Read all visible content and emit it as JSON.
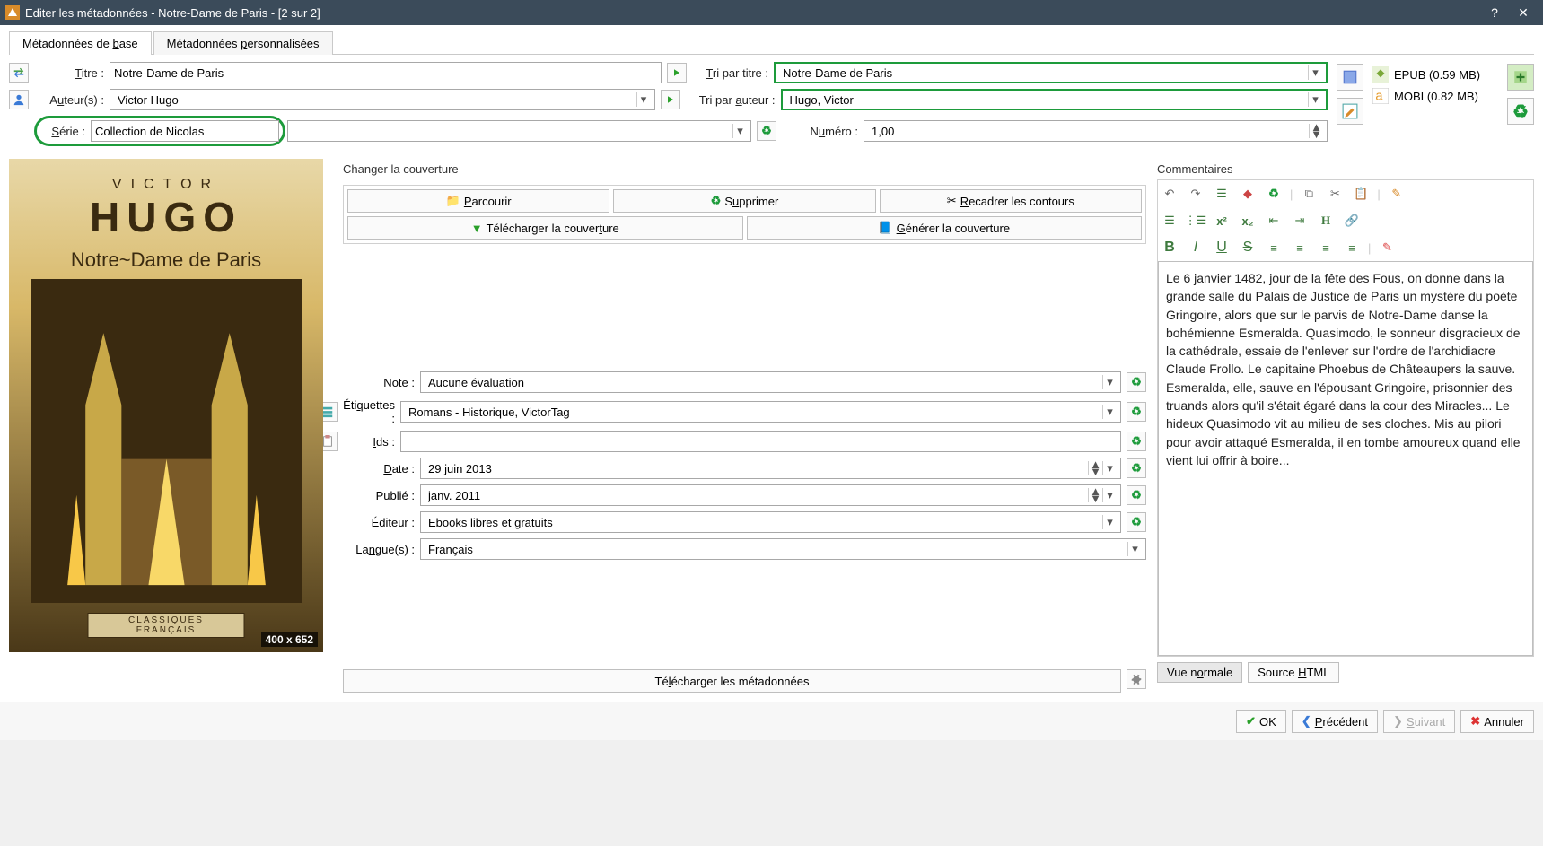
{
  "window": {
    "title": "Editer les métadonnées - Notre-Dame de Paris -  [2 sur 2]"
  },
  "tabs": {
    "basic": "Métadonnées de base",
    "custom": "Métadonnées personnalisées"
  },
  "labels": {
    "title": "Titre :",
    "authors": "Auteur(s) :",
    "series": "Série :",
    "sortTitle": "Tri par titre :",
    "sortAuthor": "Tri par auteur :",
    "number": "Numéro :",
    "changeCover": "Changer la couverture",
    "browse": "Parcourir",
    "delete": "Supprimer",
    "trim": "Recadrer les contours",
    "downloadCover": "Télécharger la couverture",
    "generateCover": "Générer la couverture",
    "rating": "Note :",
    "tags": "Étiquettes :",
    "ids": "Ids :",
    "date": "Date :",
    "published": "Publié :",
    "publisher": "Éditeur :",
    "languages": "Langue(s) :",
    "downloadMeta": "Télécharger les métadonnées",
    "comments": "Commentaires",
    "viewNormal": "Vue normale",
    "viewSource": "Source HTML",
    "ok": "OK",
    "prev": "Précédent",
    "next": "Suivant",
    "cancel": "Annuler"
  },
  "fields": {
    "title": "Notre-Dame de Paris",
    "authors": "Victor Hugo",
    "series": "Collection de Nicolas",
    "sortTitle": "Notre-Dame de Paris",
    "sortAuthor": "Hugo, Victor",
    "number": "1,00",
    "rating": "Aucune évaluation",
    "tags": "Romans - Historique, VictorTag",
    "ids": "",
    "date": "29 juin 2013",
    "published": "janv. 2011",
    "publisher": "Ebooks libres et gratuits",
    "languages": "Français"
  },
  "cover": {
    "author": "VICTOR",
    "authorLast": "HUGO",
    "bookTitle": "Notre~Dame de Paris",
    "collection": "CLASSIQUES FRANÇAIS",
    "dimensions": "400 x 652"
  },
  "formats": {
    "epub": "EPUB (0.59 MB)",
    "mobi": "MOBI (0.82 MB)"
  },
  "comments": "Le 6 janvier 1482, jour de la fête des Fous, on donne dans la grande salle du Palais de Justice de Paris un mystère du poète Gringoire, alors que sur le parvis de Notre-Dame danse la bohémienne Esmeralda. Quasimodo, le sonneur disgracieux de la cathédrale, essaie de l'enlever sur l'ordre de l'archidiacre Claude Frollo. Le capitaine Phoebus de Châteaupers la sauve. Esmeralda, elle, sauve en l'épousant Gringoire, prisonnier des truands alors qu'il s'était égaré dans la cour des Miracles... Le hideux Quasimodo vit au milieu de ses cloches. Mis au pilori pour avoir attaqué Esmeralda, il en tombe amoureux quand elle vient lui offrir à boire..."
}
